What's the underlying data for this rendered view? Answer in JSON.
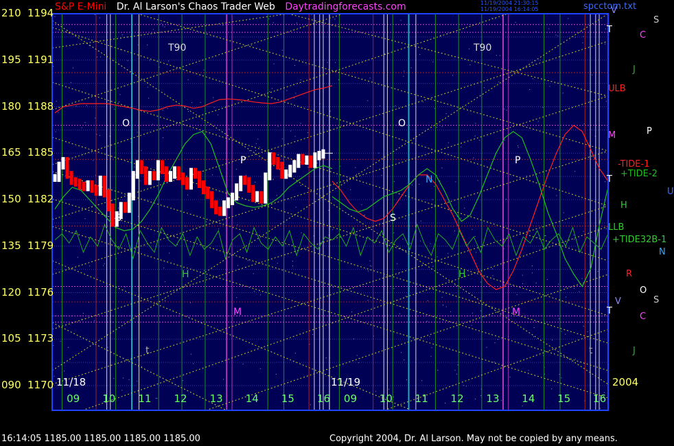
{
  "title": {
    "symbol": "S&P E-Mini",
    "main": "Dr. Al Larson's Chaos Trader Web",
    "site": "Daytradingforecasts.com",
    "stamp1": "11/19/2004 21:30:15",
    "stamp2": "11/19/2004 16:14:05",
    "file": "spcctom.txt"
  },
  "footer": {
    "quote": "16:14:05  1185.00 1185.00 1185.00 1185.00",
    "copyright": "Copyright 2004, Dr. Al Larson. May not be copied by any means."
  },
  "colors": {
    "background": "#000000",
    "plot": "#000055",
    "border": "#1e44ff",
    "price_up": "#ffffff",
    "price_down": "#ff0000",
    "tide_red": "#ff2020",
    "tide_green": "#20c020",
    "tide32": "#22aa22",
    "grid_yellow": "#cccc22",
    "axis_text": "#ffff66",
    "hour_text": "#66ff66"
  },
  "chart_data": {
    "type": "line",
    "title": "Dr. Al Larson's Chaos Trader Web",
    "symbol": "S&P E-Mini",
    "ylabels_left": [
      "210",
      "195",
      "180",
      "165",
      "150",
      "135",
      "120",
      "105",
      "090"
    ],
    "ylabels_right": [
      "1194",
      "1191",
      "1188",
      "1185",
      "1182",
      "1179",
      "1176",
      "1173",
      "1170"
    ],
    "ylim": [
      1170,
      1194
    ],
    "ylim_left": [
      90,
      210
    ],
    "x_hours": [
      "09",
      "10",
      "11",
      "12",
      "13",
      "14",
      "15",
      "16",
      "09",
      "10",
      "11",
      "12",
      "13",
      "14",
      "15",
      "16"
    ],
    "days": [
      "11/18",
      "11/19"
    ],
    "year": "2004",
    "day1": {
      "start_hour": 8.5,
      "end_hour": 16.25,
      "price_close": [
        1183.4,
        1184.2,
        1184.5,
        1183.6,
        1183.2,
        1183.1,
        1182.9,
        1182.8,
        1183.0,
        1182.7,
        1182.5,
        1183.3,
        1182.4,
        1181.5,
        1180.5,
        1181.0,
        1181.6,
        1181.4,
        1182.2,
        1183.6,
        1184.3,
        1183.9,
        1183.2,
        1183.6,
        1183.5,
        1184.3,
        1183.9,
        1183.4,
        1183.6,
        1183.9,
        1183.5,
        1183.2,
        1182.9,
        1183.8,
        1183.6,
        1183.0,
        1182.6,
        1182.3,
        1181.7,
        1181.3,
        1181.2,
        1181.7,
        1181.9,
        1182.2,
        1182.8,
        1183.3,
        1183.2,
        1182.7,
        1182.1,
        1182.3,
        1182.0,
        1183.5,
        1184.8,
        1184.5,
        1184.2,
        1183.6,
        1183.7,
        1184.0,
        1184.3,
        1184.7,
        1184.5,
        1184.6,
        1184.3,
        1184.8,
        1184.9,
        1185.0
      ],
      "tide_1_left": [
        178,
        180,
        180.5,
        181,
        181,
        181,
        181,
        180.5,
        180,
        179.5,
        178.8,
        178.5,
        179,
        180,
        180.5,
        180.2,
        179.5,
        180,
        181.2,
        182.3,
        182.5,
        182.3,
        182,
        181.5,
        181.2,
        181,
        181.5,
        182.5,
        183.5,
        184.5,
        185.5,
        186,
        186.8
      ],
      "tide_2_left": [
        147,
        151,
        154,
        153,
        150,
        147,
        144,
        141,
        140,
        140.5,
        143,
        147,
        152,
        158,
        163,
        168,
        171,
        172,
        168,
        160,
        152,
        149,
        148,
        147.5,
        148,
        149,
        151,
        154,
        156,
        158,
        160,
        161,
        160
      ],
      "tide32_left": [
        137,
        139,
        136,
        140,
        133,
        138,
        135,
        142,
        137,
        134,
        139,
        131,
        140,
        136,
        133,
        141,
        137,
        135,
        139,
        132,
        138,
        134,
        136,
        140,
        131,
        137,
        139,
        133,
        141,
        136,
        134,
        138,
        135,
        140,
        132,
        139,
        136,
        134,
        138,
        137
      ]
    },
    "day2": {
      "start_hour": 8.5,
      "end_hour": 16.25,
      "tide_1_left": [
        156,
        153,
        149,
        146,
        144,
        143,
        144,
        147,
        151,
        155,
        158,
        158,
        155,
        150,
        145,
        139,
        133,
        127,
        123,
        121,
        122,
        127,
        134,
        142,
        150,
        158,
        165,
        171,
        174,
        172,
        166,
        160,
        156
      ],
      "tide_2_left": [
        151,
        149,
        147,
        146,
        147,
        149,
        151,
        152,
        153,
        155,
        158,
        160,
        158,
        153,
        147,
        143,
        145,
        151,
        158,
        165,
        170,
        172,
        170,
        163,
        155,
        146,
        139,
        131,
        126,
        122,
        128,
        142,
        154
      ],
      "tide32_left": [
        137,
        139,
        135,
        141,
        132,
        138,
        136,
        140,
        133,
        137,
        139,
        134,
        142,
        136,
        132,
        139,
        137,
        134,
        140,
        135,
        138,
        133,
        141,
        137,
        135,
        139,
        132,
        138,
        136,
        140,
        134,
        137,
        139,
        135,
        141,
        133,
        138,
        136,
        134,
        139
      ]
    },
    "right_labels": [
      {
        "text": "V",
        "color": "#8888ff"
      },
      {
        "text": "S",
        "color": "#cccccc"
      },
      {
        "text": "T",
        "color": "#ffffff"
      },
      {
        "text": "C",
        "color": "#ff44ff"
      },
      {
        "text": "J",
        "color": "#33aa33"
      },
      {
        "text": "ULB",
        "color": "#ff2020"
      },
      {
        "text": "M",
        "color": "#ff44ff"
      },
      {
        "text": "P",
        "color": "#ffffff"
      },
      {
        "text": "-TIDE-1",
        "color": "#ff2020"
      },
      {
        "text": "+TIDE-2",
        "color": "#20c020"
      },
      {
        "text": "T",
        "color": "#ffffff"
      },
      {
        "text": "U",
        "color": "#3a6bff"
      },
      {
        "text": "H",
        "color": "#33cc33"
      },
      {
        "text": "LLB",
        "color": "#33cc33"
      },
      {
        "text": "+TIDE32B-1",
        "color": "#33cc33"
      },
      {
        "text": "N",
        "color": "#33aaff"
      },
      {
        "text": "R",
        "color": "#ff2020"
      },
      {
        "text": "O",
        "color": "#ffffff"
      },
      {
        "text": "S",
        "color": "#cccccc"
      },
      {
        "text": "V",
        "color": "#8888ff"
      },
      {
        "text": "T",
        "color": "#ffffff"
      },
      {
        "text": "C",
        "color": "#ff44ff"
      },
      {
        "text": "J",
        "color": "#33aa33"
      }
    ],
    "plot_annotations": [
      {
        "text": "T90",
        "color": "#dddddd"
      },
      {
        "text": "O",
        "color": "#ffffff"
      },
      {
        "text": "P",
        "color": "#ffffff"
      },
      {
        "text": "S",
        "color": "#ffffff"
      },
      {
        "text": "H",
        "color": "#33cc33"
      },
      {
        "text": "M",
        "color": "#ff44ff"
      },
      {
        "text": "t",
        "color": "#aaaaaa"
      },
      {
        "text": "T90",
        "color": "#dddddd"
      },
      {
        "text": "O",
        "color": "#ffffff"
      },
      {
        "text": "P",
        "color": "#ffffff"
      },
      {
        "text": "S",
        "color": "#ffffff"
      },
      {
        "text": "H",
        "color": "#33cc33"
      },
      {
        "text": "M",
        "color": "#ff44ff"
      },
      {
        "text": "N",
        "color": "#33aaff"
      },
      {
        "text": "t",
        "color": "#aaaaaa"
      }
    ],
    "grid": true,
    "legend": "right"
  }
}
